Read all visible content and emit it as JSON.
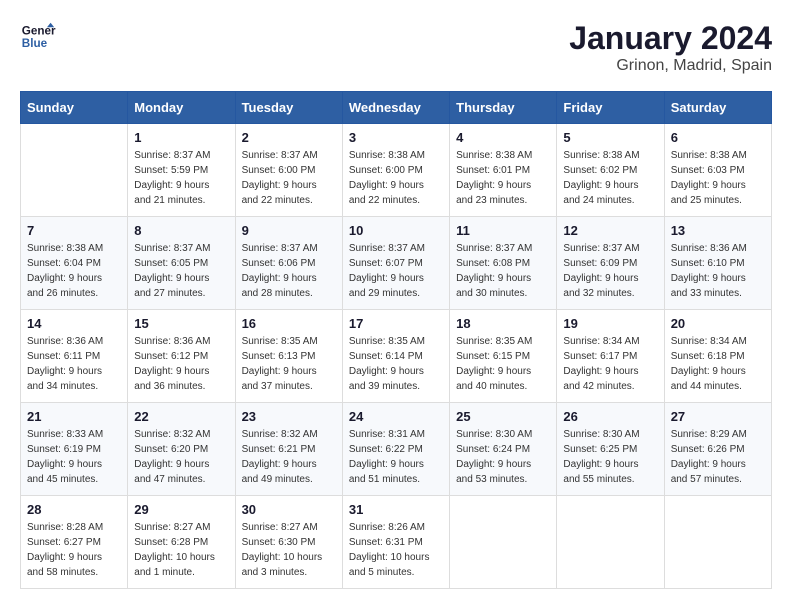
{
  "header": {
    "logo_line1": "General",
    "logo_line2": "Blue",
    "month": "January 2024",
    "location": "Grinon, Madrid, Spain"
  },
  "weekdays": [
    "Sunday",
    "Monday",
    "Tuesday",
    "Wednesday",
    "Thursday",
    "Friday",
    "Saturday"
  ],
  "weeks": [
    [
      {
        "day": "",
        "sunrise": "",
        "sunset": "",
        "daylight": ""
      },
      {
        "day": "1",
        "sunrise": "Sunrise: 8:37 AM",
        "sunset": "Sunset: 5:59 PM",
        "daylight": "Daylight: 9 hours and 21 minutes."
      },
      {
        "day": "2",
        "sunrise": "Sunrise: 8:37 AM",
        "sunset": "Sunset: 6:00 PM",
        "daylight": "Daylight: 9 hours and 22 minutes."
      },
      {
        "day": "3",
        "sunrise": "Sunrise: 8:38 AM",
        "sunset": "Sunset: 6:00 PM",
        "daylight": "Daylight: 9 hours and 22 minutes."
      },
      {
        "day": "4",
        "sunrise": "Sunrise: 8:38 AM",
        "sunset": "Sunset: 6:01 PM",
        "daylight": "Daylight: 9 hours and 23 minutes."
      },
      {
        "day": "5",
        "sunrise": "Sunrise: 8:38 AM",
        "sunset": "Sunset: 6:02 PM",
        "daylight": "Daylight: 9 hours and 24 minutes."
      },
      {
        "day": "6",
        "sunrise": "Sunrise: 8:38 AM",
        "sunset": "Sunset: 6:03 PM",
        "daylight": "Daylight: 9 hours and 25 minutes."
      }
    ],
    [
      {
        "day": "7",
        "sunrise": "Sunrise: 8:38 AM",
        "sunset": "Sunset: 6:04 PM",
        "daylight": "Daylight: 9 hours and 26 minutes."
      },
      {
        "day": "8",
        "sunrise": "Sunrise: 8:37 AM",
        "sunset": "Sunset: 6:05 PM",
        "daylight": "Daylight: 9 hours and 27 minutes."
      },
      {
        "day": "9",
        "sunrise": "Sunrise: 8:37 AM",
        "sunset": "Sunset: 6:06 PM",
        "daylight": "Daylight: 9 hours and 28 minutes."
      },
      {
        "day": "10",
        "sunrise": "Sunrise: 8:37 AM",
        "sunset": "Sunset: 6:07 PM",
        "daylight": "Daylight: 9 hours and 29 minutes."
      },
      {
        "day": "11",
        "sunrise": "Sunrise: 8:37 AM",
        "sunset": "Sunset: 6:08 PM",
        "daylight": "Daylight: 9 hours and 30 minutes."
      },
      {
        "day": "12",
        "sunrise": "Sunrise: 8:37 AM",
        "sunset": "Sunset: 6:09 PM",
        "daylight": "Daylight: 9 hours and 32 minutes."
      },
      {
        "day": "13",
        "sunrise": "Sunrise: 8:36 AM",
        "sunset": "Sunset: 6:10 PM",
        "daylight": "Daylight: 9 hours and 33 minutes."
      }
    ],
    [
      {
        "day": "14",
        "sunrise": "Sunrise: 8:36 AM",
        "sunset": "Sunset: 6:11 PM",
        "daylight": "Daylight: 9 hours and 34 minutes."
      },
      {
        "day": "15",
        "sunrise": "Sunrise: 8:36 AM",
        "sunset": "Sunset: 6:12 PM",
        "daylight": "Daylight: 9 hours and 36 minutes."
      },
      {
        "day": "16",
        "sunrise": "Sunrise: 8:35 AM",
        "sunset": "Sunset: 6:13 PM",
        "daylight": "Daylight: 9 hours and 37 minutes."
      },
      {
        "day": "17",
        "sunrise": "Sunrise: 8:35 AM",
        "sunset": "Sunset: 6:14 PM",
        "daylight": "Daylight: 9 hours and 39 minutes."
      },
      {
        "day": "18",
        "sunrise": "Sunrise: 8:35 AM",
        "sunset": "Sunset: 6:15 PM",
        "daylight": "Daylight: 9 hours and 40 minutes."
      },
      {
        "day": "19",
        "sunrise": "Sunrise: 8:34 AM",
        "sunset": "Sunset: 6:17 PM",
        "daylight": "Daylight: 9 hours and 42 minutes."
      },
      {
        "day": "20",
        "sunrise": "Sunrise: 8:34 AM",
        "sunset": "Sunset: 6:18 PM",
        "daylight": "Daylight: 9 hours and 44 minutes."
      }
    ],
    [
      {
        "day": "21",
        "sunrise": "Sunrise: 8:33 AM",
        "sunset": "Sunset: 6:19 PM",
        "daylight": "Daylight: 9 hours and 45 minutes."
      },
      {
        "day": "22",
        "sunrise": "Sunrise: 8:32 AM",
        "sunset": "Sunset: 6:20 PM",
        "daylight": "Daylight: 9 hours and 47 minutes."
      },
      {
        "day": "23",
        "sunrise": "Sunrise: 8:32 AM",
        "sunset": "Sunset: 6:21 PM",
        "daylight": "Daylight: 9 hours and 49 minutes."
      },
      {
        "day": "24",
        "sunrise": "Sunrise: 8:31 AM",
        "sunset": "Sunset: 6:22 PM",
        "daylight": "Daylight: 9 hours and 51 minutes."
      },
      {
        "day": "25",
        "sunrise": "Sunrise: 8:30 AM",
        "sunset": "Sunset: 6:24 PM",
        "daylight": "Daylight: 9 hours and 53 minutes."
      },
      {
        "day": "26",
        "sunrise": "Sunrise: 8:30 AM",
        "sunset": "Sunset: 6:25 PM",
        "daylight": "Daylight: 9 hours and 55 minutes."
      },
      {
        "day": "27",
        "sunrise": "Sunrise: 8:29 AM",
        "sunset": "Sunset: 6:26 PM",
        "daylight": "Daylight: 9 hours and 57 minutes."
      }
    ],
    [
      {
        "day": "28",
        "sunrise": "Sunrise: 8:28 AM",
        "sunset": "Sunset: 6:27 PM",
        "daylight": "Daylight: 9 hours and 58 minutes."
      },
      {
        "day": "29",
        "sunrise": "Sunrise: 8:27 AM",
        "sunset": "Sunset: 6:28 PM",
        "daylight": "Daylight: 10 hours and 1 minute."
      },
      {
        "day": "30",
        "sunrise": "Sunrise: 8:27 AM",
        "sunset": "Sunset: 6:30 PM",
        "daylight": "Daylight: 10 hours and 3 minutes."
      },
      {
        "day": "31",
        "sunrise": "Sunrise: 8:26 AM",
        "sunset": "Sunset: 6:31 PM",
        "daylight": "Daylight: 10 hours and 5 minutes."
      },
      {
        "day": "",
        "sunrise": "",
        "sunset": "",
        "daylight": ""
      },
      {
        "day": "",
        "sunrise": "",
        "sunset": "",
        "daylight": ""
      },
      {
        "day": "",
        "sunrise": "",
        "sunset": "",
        "daylight": ""
      }
    ]
  ]
}
